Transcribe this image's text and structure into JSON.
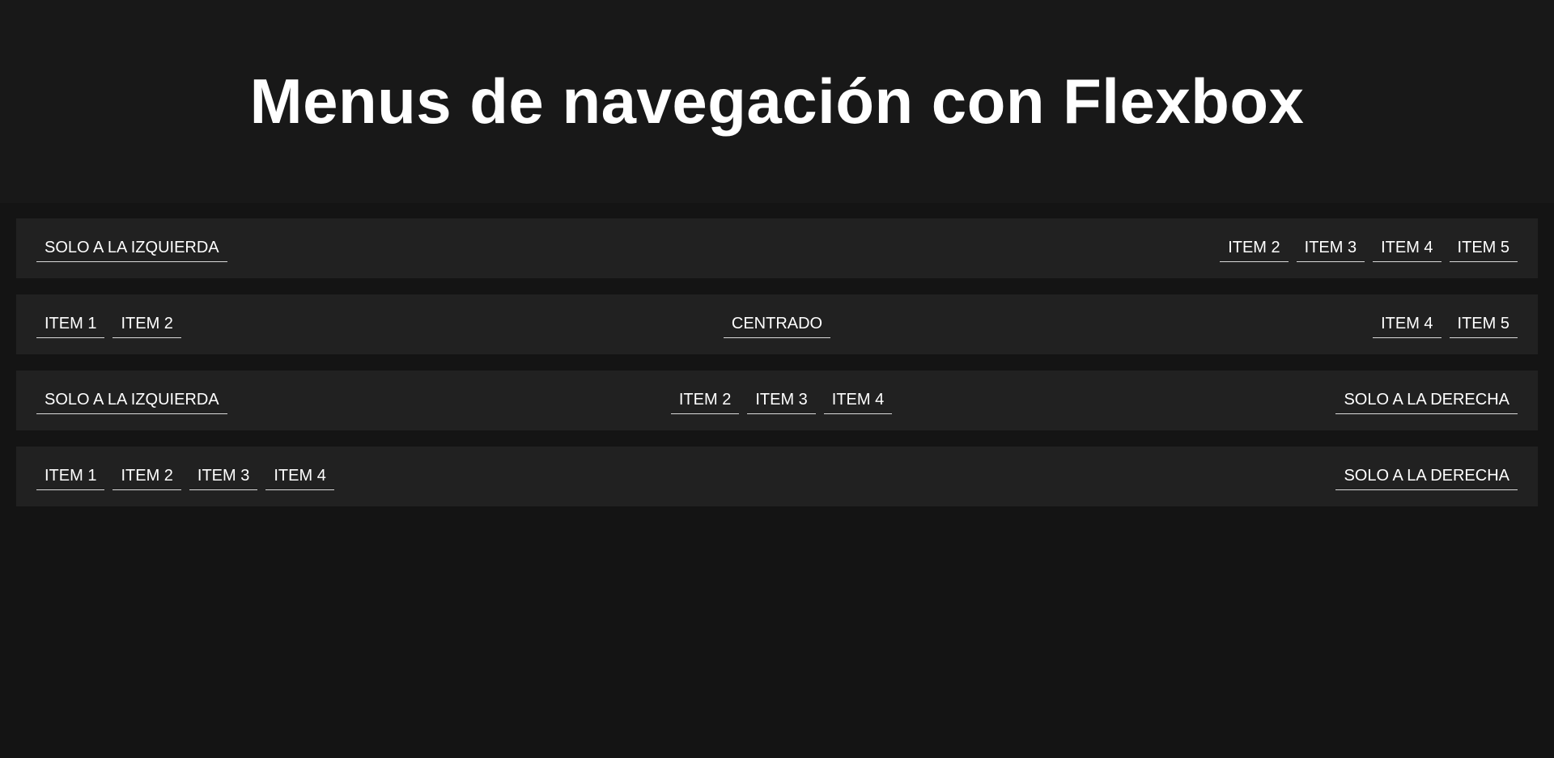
{
  "header": {
    "title": "Menus de navegación con Flexbox"
  },
  "menus": [
    {
      "left": [
        "SOLO A LA IZQUIERDA"
      ],
      "center": [],
      "right": [
        "ITEM 2",
        "ITEM 3",
        "ITEM 4",
        "ITEM 5"
      ]
    },
    {
      "left": [
        "ITEM 1",
        "ITEM 2"
      ],
      "center": [
        "CENTRADO"
      ],
      "right": [
        "ITEM 4",
        "ITEM 5"
      ]
    },
    {
      "left": [
        "SOLO A LA IZQUIERDA"
      ],
      "center": [
        "ITEM 2",
        "ITEM 3",
        "ITEM 4"
      ],
      "right": [
        "SOLO A LA DERECHA"
      ]
    },
    {
      "left": [
        "ITEM 1",
        "ITEM 2",
        "ITEM 3",
        "ITEM 4"
      ],
      "center": [],
      "right": [
        "SOLO A LA DERECHA"
      ]
    }
  ]
}
